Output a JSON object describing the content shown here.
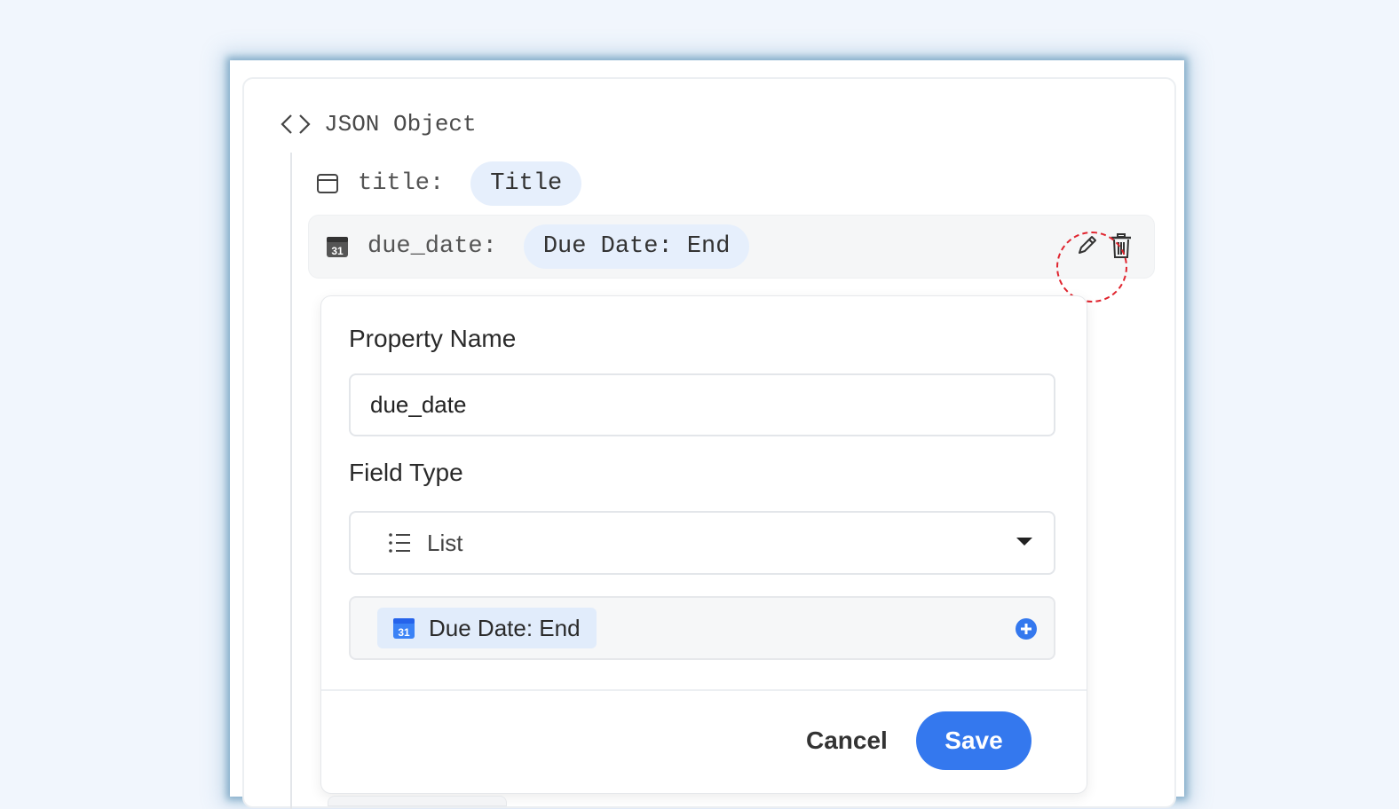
{
  "header": {
    "title": "JSON Object",
    "icon": "code-brackets-icon"
  },
  "properties": [
    {
      "key": "title:",
      "value": "Title",
      "icon": "window-icon"
    },
    {
      "key": "due_date:",
      "value": "Due Date: End",
      "icon": "calendar-icon"
    }
  ],
  "row_actions": {
    "edit_icon": "pencil-icon",
    "delete_icon": "trash-icon"
  },
  "editor": {
    "property_name_label": "Property Name",
    "property_name_value": "due_date",
    "field_type_label": "Field Type",
    "field_type_value": "List",
    "field_type_icon": "list-icon",
    "list_items": [
      {
        "label": "Due Date: End",
        "icon": "calendar-icon"
      }
    ],
    "add_icon": "plus-circle-icon",
    "cancel_label": "Cancel",
    "save_label": "Save"
  },
  "colors": {
    "accent": "#3478ee",
    "pill_bg": "#e6effc",
    "highlight": "#e0242e"
  }
}
